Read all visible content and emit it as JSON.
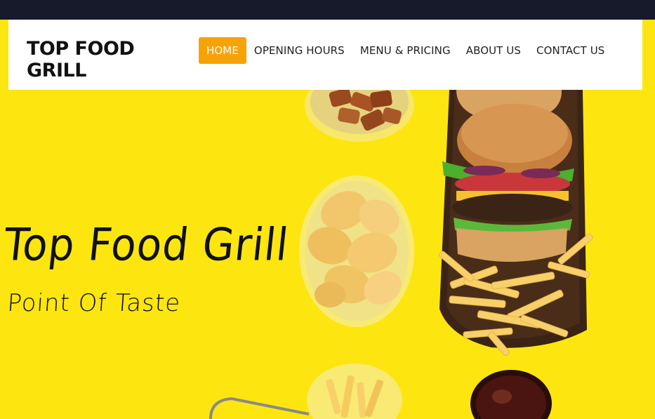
{
  "brand": {
    "name_line1": "TOP FOOD",
    "name_line2": "GRILL"
  },
  "nav": {
    "items": [
      {
        "label": "HOME",
        "active": true
      },
      {
        "label": "OPENING HOURS",
        "active": false
      },
      {
        "label": "MENU & PRICING",
        "active": false
      },
      {
        "label": "ABOUT US",
        "active": false
      },
      {
        "label": "CONTACT US",
        "active": false
      }
    ]
  },
  "hero": {
    "title": "Top Food Grill",
    "subtitle": "Point Of Taste",
    "background_color": "#fde60f"
  },
  "colors": {
    "topbar": "#171a2a",
    "accent": "#f7a207",
    "header_bg": "#ffffff",
    "text": "#111111"
  },
  "icons": [
    "croutons-bowl",
    "chips-bowl",
    "burger-tray",
    "fries",
    "soda-cup",
    "fry-basket"
  ]
}
